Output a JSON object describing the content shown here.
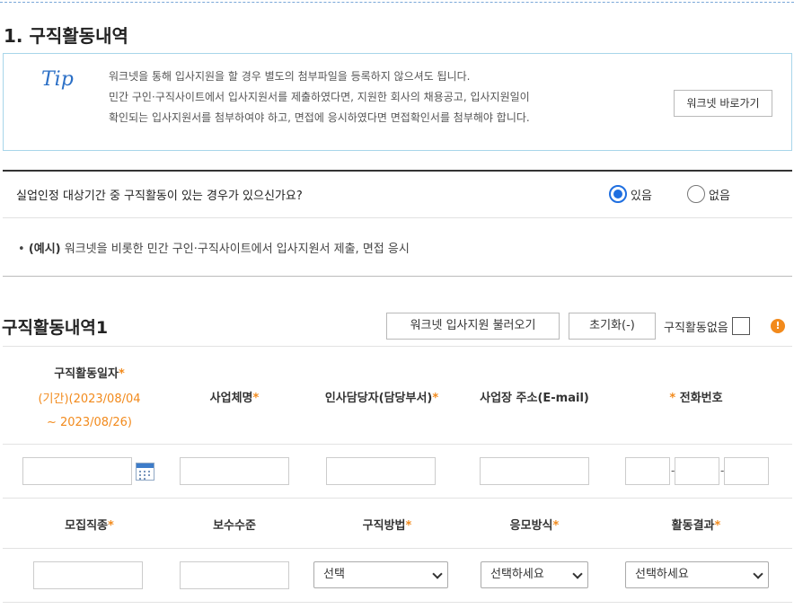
{
  "section_title": "1. 구직활동내역",
  "tip": {
    "label": "Tip",
    "lines": [
      "워크넷을 통해 입사지원을 할 경우 별도의 첨부파일을 등록하지 않으셔도 됩니다.",
      "민간 구인·구직사이트에서 입사지원서를 제출하였다면, 지원한 회사의 채용공고, 입사지원일이",
      "확인되는 입사지원서를 첨부하여야 하고, 면접에 응시하였다면 면접확인서를 첨부해야 합니다."
    ],
    "button_label": "워크넷 바로가기"
  },
  "question": {
    "text": "실업인정 대상기간 중 구직활동이 있는 경우가 있으신가요?",
    "yes_label": "있음",
    "no_label": "없음",
    "selected": "yes",
    "accent_color": "#1f6fe0"
  },
  "example": {
    "prefix": "(예시)",
    "text": "워크넷을 비롯한 민간 구인·구직사이트에서 입사지원서 제출, 면접 응시"
  },
  "activity": {
    "title": "구직활동내역1",
    "load_button": "워크넷 입사지원 불러오기",
    "reset_button": "초기화(-)",
    "no_activity_label": "구직활동없음",
    "warn_icon_symbol": "!",
    "headers_row1": {
      "date": "구직활동일자",
      "company": "사업체명",
      "manager": "인사담당자(담당부서)",
      "address": "사업장 주소(E-mail)",
      "phone": "전화번호"
    },
    "period_line1": "(기간)(2023/08/04",
    "period_line2": "~ 2023/08/26)",
    "headers_row2": {
      "job": "모집직종",
      "salary": "보수수준",
      "method": "구직방법",
      "apply": "응모방식",
      "result": "활동결과"
    },
    "selects": {
      "method": "선택",
      "apply": "선택하세요",
      "result": "선택하세요"
    },
    "phone_separator": "-",
    "required_mark": "*",
    "required_color": "#f28a1c"
  }
}
